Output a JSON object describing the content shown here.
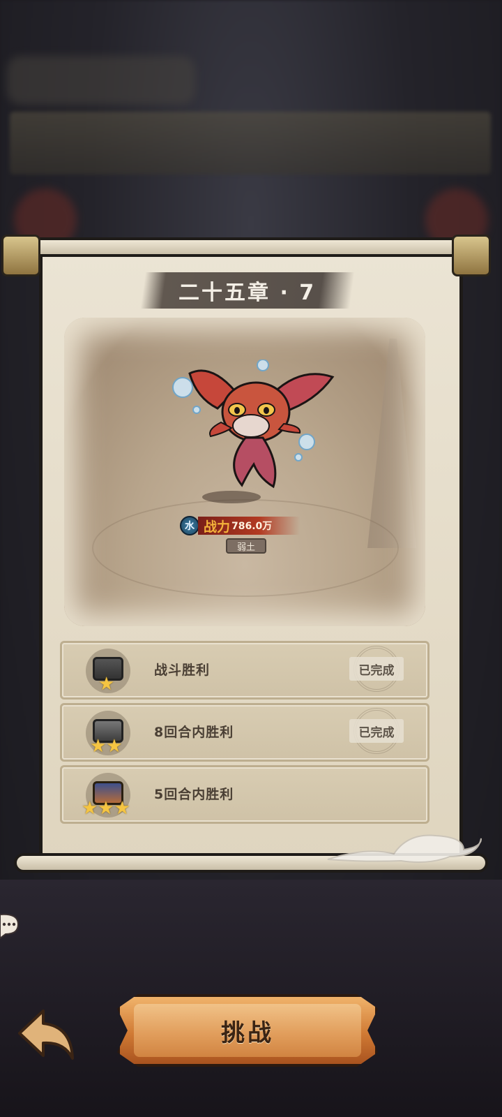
{
  "chapter": {
    "title": "二十五章 · 7"
  },
  "enemy": {
    "element": "水",
    "power_label": "战力",
    "power_value": "786.0万",
    "rank": "弱土",
    "element_color": "#2f6f96"
  },
  "objectives": [
    {
      "label": "战斗胜利",
      "stars": 1,
      "status": "已完成"
    },
    {
      "label": "8回合内胜利",
      "stars": 2,
      "status": "已完成"
    },
    {
      "label": "5回合内胜利",
      "stars": 3,
      "status": ""
    }
  ],
  "buttons": {
    "challenge_label": "挑战"
  },
  "icons": {
    "back": "back-arrow-icon",
    "chat": "chat-bubble-icon",
    "star": "star-icon",
    "chest": "chest-icon"
  },
  "colors": {
    "accent": "#d07a34",
    "star": "#f5c542",
    "panel": "#e6dece"
  }
}
